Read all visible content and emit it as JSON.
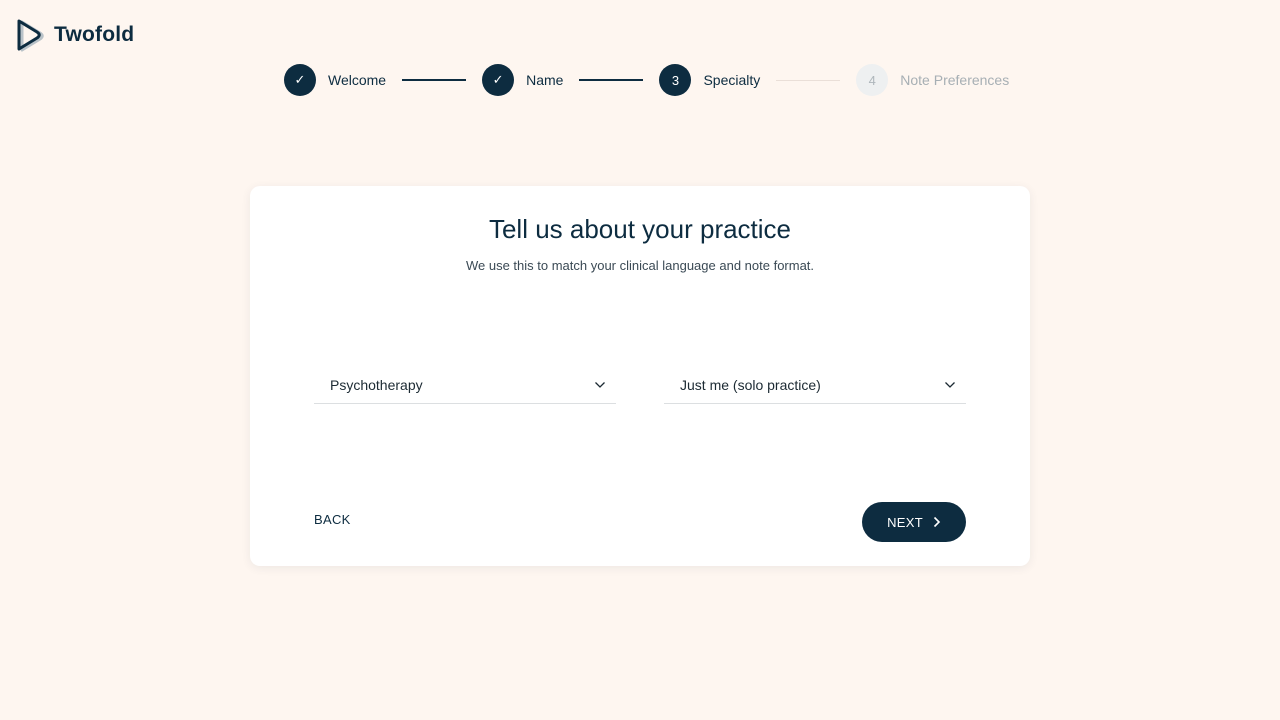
{
  "brand": {
    "name": "Twofold"
  },
  "stepper": {
    "steps": [
      {
        "marker": "✓",
        "label": "Welcome",
        "status": "complete"
      },
      {
        "marker": "✓",
        "label": "Name",
        "status": "complete"
      },
      {
        "marker": "3",
        "label": "Specialty",
        "status": "current"
      },
      {
        "marker": "4",
        "label": "Note Preferences",
        "status": "upcoming"
      }
    ]
  },
  "card": {
    "title": "Tell us about your practice",
    "subtitle": "We use this to match your clinical language and note format.",
    "specialty_select": {
      "value": "Psychotherapy"
    },
    "practice_select": {
      "value": "Just me (solo practice)"
    },
    "back_label": "BACK",
    "next_label": "NEXT"
  },
  "colors": {
    "background": "#fef6f0",
    "primary": "#0d2c40",
    "inactive_step": "#eef0f1",
    "card": "#ffffff"
  }
}
